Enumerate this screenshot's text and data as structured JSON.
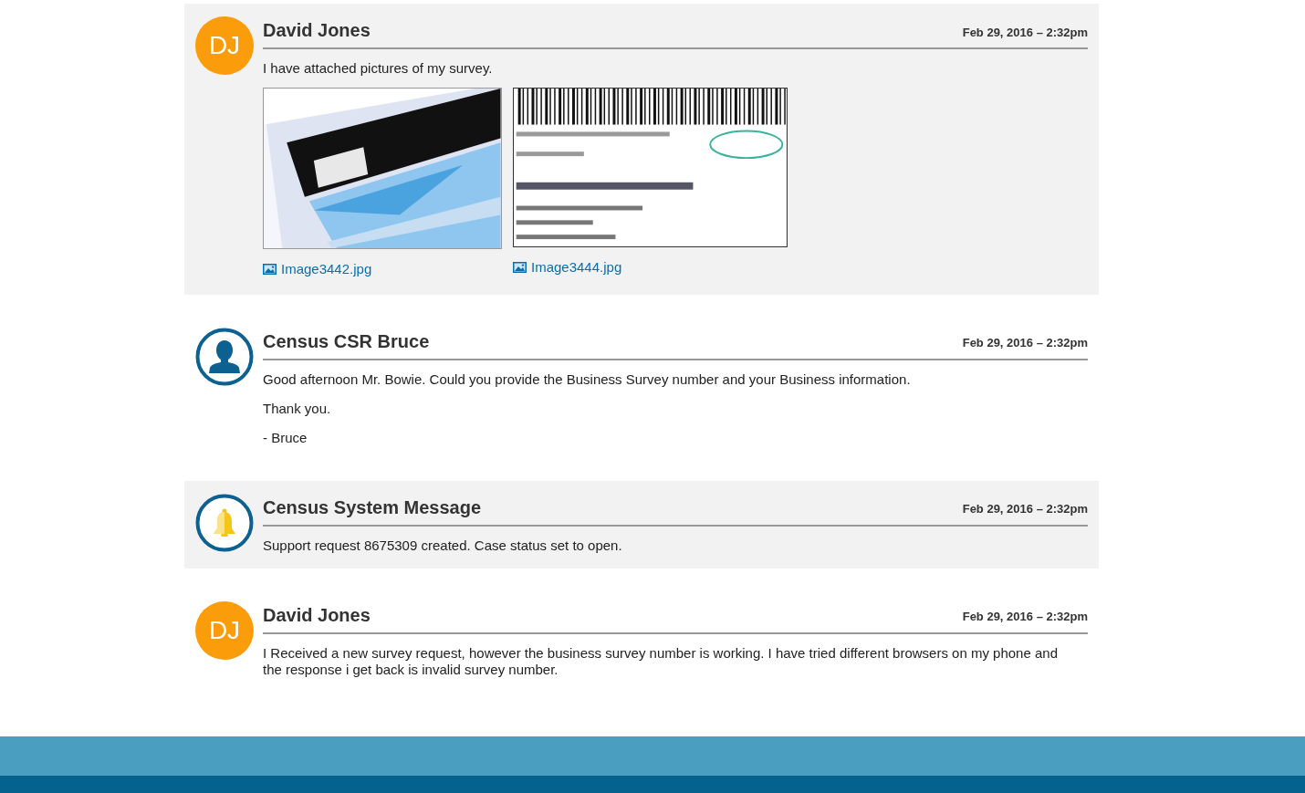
{
  "messages": [
    {
      "kind": "user",
      "shaded": true,
      "initials": "DJ",
      "author": "David Jones",
      "time": "Feb 29, 2016 – 2:32pm",
      "paragraphs": [
        "I have attached pictures of my survey."
      ],
      "attachments": [
        {
          "kind": "picture",
          "filename": "Image3442.jpg"
        },
        {
          "kind": "picture",
          "filename": "Image3444.jpg"
        }
      ]
    },
    {
      "kind": "agent",
      "shaded": false,
      "author": "Census CSR Bruce",
      "time": "Feb 29, 2016 – 2:32pm",
      "paragraphs": [
        "Good afternoon Mr. Bowie. Could you provide the Business Survey number and your Business information.",
        "Thank you.",
        "- Bruce"
      ]
    },
    {
      "kind": "system",
      "shaded": true,
      "author": "Census System Message",
      "time": "Feb 29, 2016 – 2:32pm",
      "paragraphs": [
        "Support request 8675309 created. Case status set to open."
      ]
    },
    {
      "kind": "user",
      "shaded": false,
      "initials": "DJ",
      "author": "David Jones",
      "time": "Feb 29, 2016 – 2:32pm",
      "paragraphs": [
        "I Received a new survey request, however the business survey number is working. I have tried different browsers on my phone and the response i get back is invalid survey number."
      ]
    }
  ]
}
